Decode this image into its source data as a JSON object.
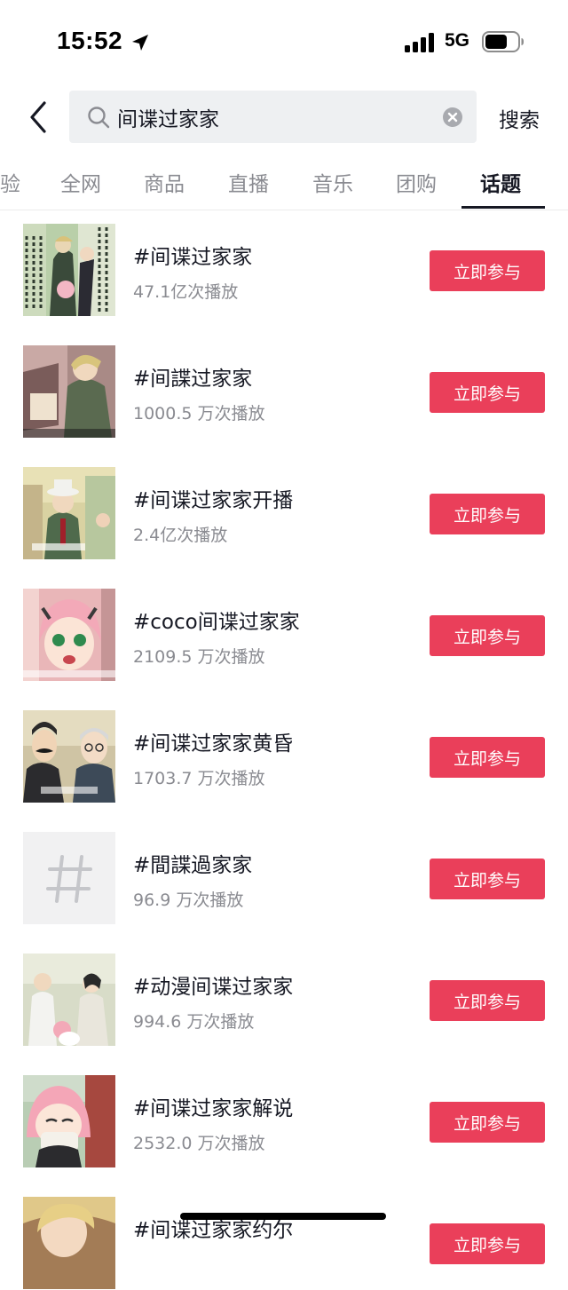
{
  "status_bar": {
    "time": "15:52",
    "network": "5G",
    "location_icon": "location-arrow-icon",
    "signal_icon": "signal-bars-icon",
    "battery_icon": "battery-icon"
  },
  "search": {
    "query": "间谍过家家",
    "submit_label": "搜索",
    "back_icon": "chevron-left-icon",
    "search_icon": "magnifier-icon",
    "clear_icon": "clear-x-icon"
  },
  "tabs": [
    {
      "label": "验"
    },
    {
      "label": "全网"
    },
    {
      "label": "商品"
    },
    {
      "label": "直播"
    },
    {
      "label": "音乐"
    },
    {
      "label": "团购"
    },
    {
      "label": "话题",
      "active": true
    }
  ],
  "topics": [
    {
      "title": "#间谍过家家",
      "plays": "47.1亿次播放",
      "button": "立即参与"
    },
    {
      "title": "#间諜过家家",
      "plays": "1000.5 万次播放",
      "button": "立即参与"
    },
    {
      "title": "#间谍过家家开播",
      "plays": "2.4亿次播放",
      "button": "立即参与"
    },
    {
      "title": "#coco间谍过家家",
      "plays": "2109.5 万次播放",
      "button": "立即参与"
    },
    {
      "title": "#间谍过家家黄昏",
      "plays": "1703.7 万次播放",
      "button": "立即参与"
    },
    {
      "title": "#間諜過家家",
      "plays": "96.9 万次播放",
      "button": "立即参与"
    },
    {
      "title": "#动漫间谍过家家",
      "plays": "994.6 万次播放",
      "button": "立即参与"
    },
    {
      "title": "#间谍过家家解说",
      "plays": "2532.0 万次播放",
      "button": "立即参与"
    },
    {
      "title": "#间谍过家家约尔",
      "plays": "",
      "button": "立即参与"
    }
  ],
  "colors": {
    "accent": "#ea3f5a",
    "text_primary": "#161823",
    "text_secondary": "#8a8b91",
    "search_bg": "#eef0f2"
  }
}
